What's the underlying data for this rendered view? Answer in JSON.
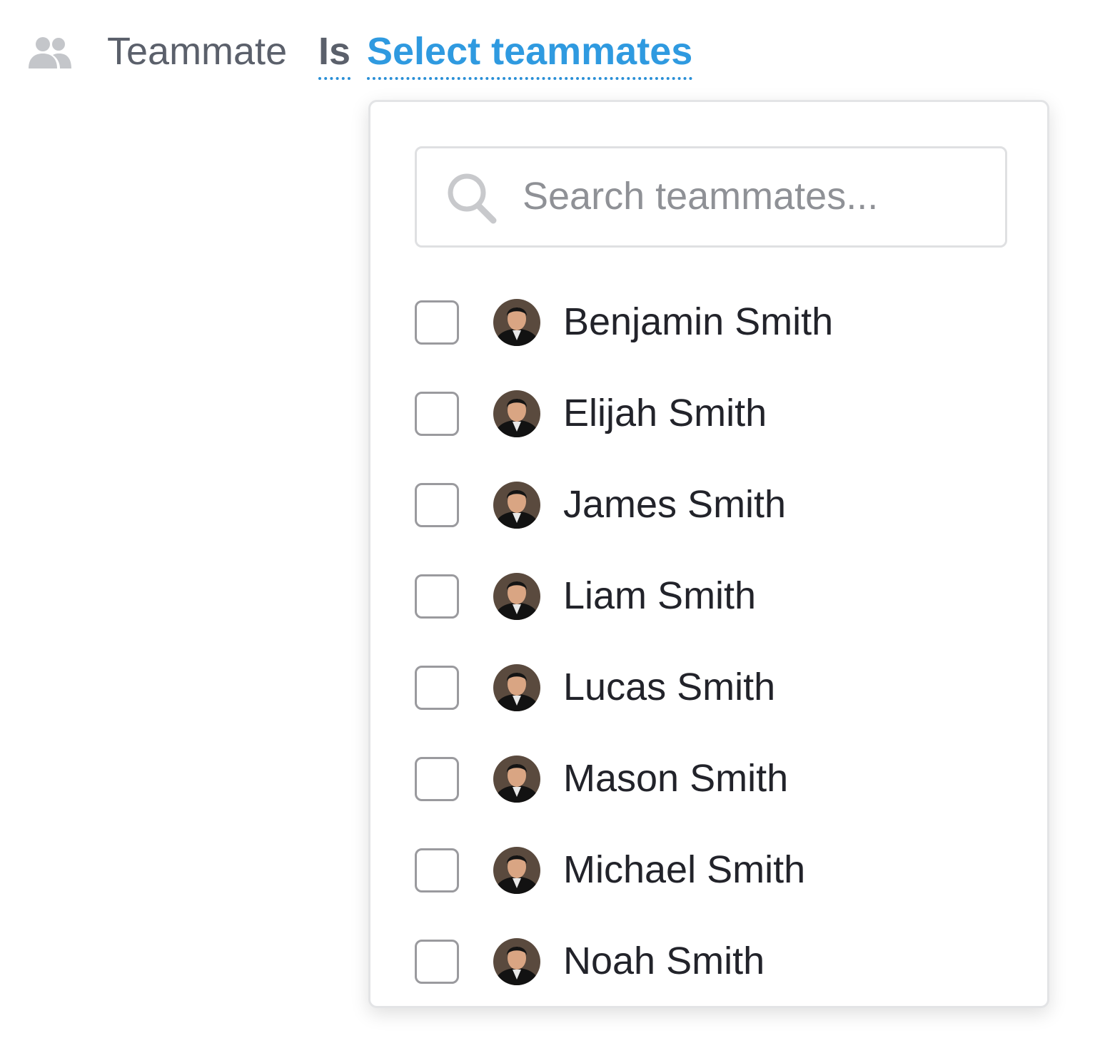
{
  "filter": {
    "icon": "people-icon",
    "attribute_label": "Teammate",
    "operator_label": "Is",
    "value_label": "Select teammates"
  },
  "dropdown": {
    "search": {
      "icon": "search-icon",
      "placeholder": "Search teammates...",
      "value": ""
    },
    "members": [
      {
        "name": "Benjamin Smith",
        "checked": false
      },
      {
        "name": "Elijah Smith",
        "checked": false
      },
      {
        "name": "James Smith",
        "checked": false
      },
      {
        "name": "Liam Smith",
        "checked": false
      },
      {
        "name": "Lucas Smith",
        "checked": false
      },
      {
        "name": "Mason Smith",
        "checked": false
      },
      {
        "name": "Michael Smith",
        "checked": false
      },
      {
        "name": "Noah Smith",
        "checked": false
      }
    ]
  },
  "colors": {
    "link": "#2f9ae0",
    "muted_text": "#5b606b",
    "name_text": "#22232a",
    "icon_gray": "#c4c6ca"
  }
}
